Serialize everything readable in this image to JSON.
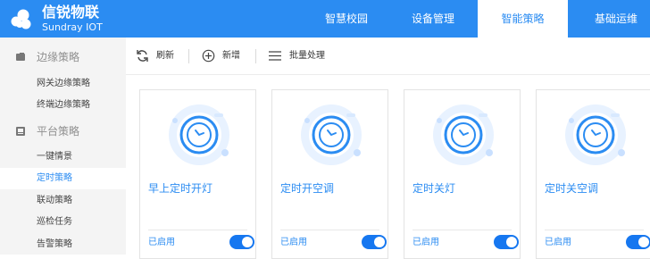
{
  "app": {
    "name": "信锐物联",
    "subtitle": "Sundray IOT"
  },
  "topnav": [
    {
      "label": "智慧校园",
      "active": false
    },
    {
      "label": "设备管理",
      "active": false
    },
    {
      "label": "智能策略",
      "active": true
    },
    {
      "label": "基础运维",
      "active": false
    }
  ],
  "sidebar": {
    "groups": [
      {
        "label": "边缘策略",
        "icon": "folder-icon",
        "items": [
          "网关边缘策略",
          "终端边缘策略"
        ]
      },
      {
        "label": "平台策略",
        "icon": "platform-icon",
        "items": [
          "一键情景",
          "定时策略",
          "联动策略",
          "巡检任务",
          "告警策略"
        ]
      }
    ],
    "active_item": "定时策略"
  },
  "toolbar": {
    "refresh_label": "刷新",
    "add_label": "新增",
    "batch_label": "批量处理"
  },
  "cards": [
    {
      "title": "早上定时开灯",
      "status": "已启用",
      "enabled": true
    },
    {
      "title": "定时开空调",
      "status": "已启用",
      "enabled": true
    },
    {
      "title": "定时关灯",
      "status": "已启用",
      "enabled": true
    },
    {
      "title": "定时关空调",
      "status": "已启用",
      "enabled": true
    }
  ],
  "colors": {
    "brand": "#2b8cf2",
    "toggle_on": "#1677f0",
    "sidebar_bg": "#f4f4f4"
  }
}
